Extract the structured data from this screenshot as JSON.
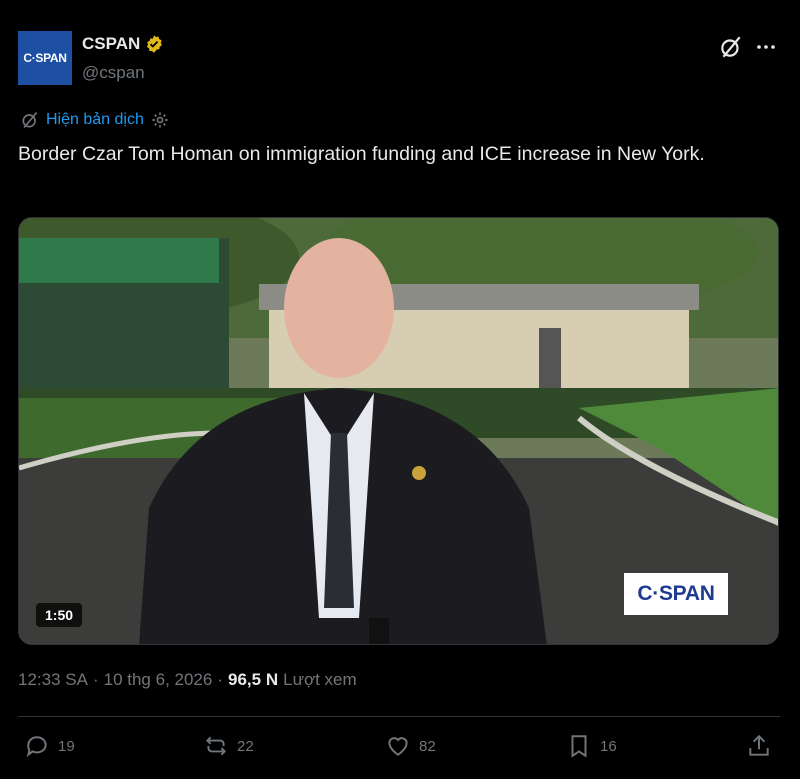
{
  "author": {
    "avatar_text": "C·SPAN",
    "display_name": "CSPAN",
    "handle": "@cspan",
    "verified_badge_icon": "verified-gold-badge-icon"
  },
  "header_icons": [
    "grok-icon",
    "more-icon"
  ],
  "translate": {
    "icon": "translate-icon",
    "label": "Hiện bản dịch",
    "settings_icon": "gear-icon"
  },
  "tweet": {
    "text": "Border Czar Tom Homan on immigration funding and ICE increase in New York."
  },
  "video": {
    "duration": "1:50",
    "overlay_logo": "C·SPAN"
  },
  "meta": {
    "time": "12:33 SA",
    "separator": "·",
    "date": "10 thg 6, 2026",
    "separator2": "·",
    "views_count": "96,5 N",
    "views_label": "Lượt xem"
  },
  "actions": {
    "replies": "19",
    "reposts": "22",
    "likes": "82",
    "bookmarks": "16"
  },
  "colors": {
    "background": "#000000",
    "text": "#e7e9ea",
    "muted": "#71767b",
    "link": "#1d9bf0",
    "badge": "#e2b719"
  }
}
